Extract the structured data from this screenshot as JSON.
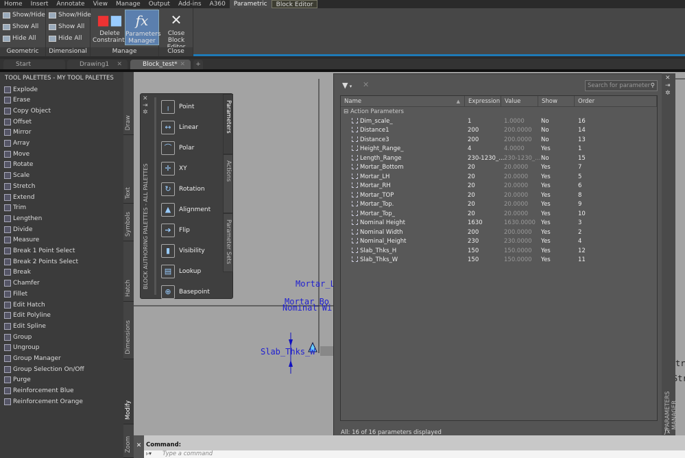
{
  "ribbon_tabs": [
    "Home",
    "Insert",
    "Annotate",
    "View",
    "Manage",
    "Output",
    "Add-ins",
    "A360",
    "Parametric",
    "Block Editor"
  ],
  "ribbon": {
    "geometric": {
      "items": [
        "Show/Hide",
        "Show All",
        "Hide All"
      ],
      "label": "Geometric"
    },
    "dimensional": {
      "items": [
        "Show/Hide",
        "Show All",
        "Hide All"
      ],
      "label": "Dimensional"
    },
    "manage": {
      "delete": "Delete Constraints",
      "params": "Parameters Manager",
      "label": "Manage"
    },
    "close": {
      "close": "Close Block Editor",
      "label": "Close"
    }
  },
  "doc_tabs": [
    "Start",
    "Drawing1",
    "Block_test*"
  ],
  "palette": {
    "title": "TOOL PALETTES - MY TOOL PALETTES",
    "items": [
      "Explode",
      "Erase",
      "Copy Object",
      "Offset",
      "Mirror",
      "Array",
      "Move",
      "Rotate",
      "Scale",
      "Stretch",
      "Extend",
      "Trim",
      "Lengthen",
      "Divide",
      "Measure",
      "Break 1 Point Select",
      "Break 2 Points Select",
      "Break",
      "Chamfer",
      "Fillet",
      "Edit Hatch",
      "Edit Polyline",
      "Edit Spline",
      "Group",
      "Ungroup",
      "Group Manager",
      "Group Selection On/Off",
      "Purge",
      "Reinforcement Blue",
      "Reinforcement Orange"
    ],
    "tabs": [
      "Draw",
      "Text",
      "Symbols",
      "Hatch",
      "Dimensions",
      "Modify",
      "Zoom"
    ],
    "active_tab": "Modify"
  },
  "block_palette": {
    "title": "BLOCK AUTHORING PALETTES - ALL PALETTES",
    "items": [
      "Point",
      "Linear",
      "Polar",
      "XY",
      "Rotation",
      "Alignment",
      "Flip",
      "Visibility",
      "Lookup",
      "Basepoint"
    ],
    "tabs": [
      "Parameters",
      "Actions",
      "Parameter Sets"
    ]
  },
  "drawing_labels": [
    "Mortar_L",
    "Mortar_Bo",
    "Nominal Wi",
    "Slab_Thks_W"
  ],
  "drawing_edge_text": [
    "tre",
    "Stre"
  ],
  "params_manager": {
    "title": "PARAMETERS MANAGER",
    "search_placeholder": "Search for parameter",
    "columns": [
      "Name",
      "Expression",
      "Value",
      "Show",
      "Order"
    ],
    "group": "Action Parameters",
    "rows": [
      [
        "Dim_scale_",
        "1",
        "1.0000",
        "No",
        "16"
      ],
      [
        "Distance1",
        "200",
        "200.0000",
        "No",
        "14"
      ],
      [
        "Distance3",
        "200",
        "200.0000",
        "No",
        "13"
      ],
      [
        "Height_Range_",
        "4",
        "4.0000",
        "Yes",
        "1"
      ],
      [
        "Length_Range",
        "230-1230_...",
        "230-1230_...",
        "No",
        "15"
      ],
      [
        "Mortar_Bottom",
        "20",
        "20.0000",
        "Yes",
        "7"
      ],
      [
        "Mortar_LH",
        "20",
        "20.0000",
        "Yes",
        "5"
      ],
      [
        "Mortar_RH",
        "20",
        "20.0000",
        "Yes",
        "6"
      ],
      [
        "Mortar_TOP",
        "20",
        "20.0000",
        "Yes",
        "8"
      ],
      [
        "Mortar_Top.",
        "20",
        "20.0000",
        "Yes",
        "9"
      ],
      [
        "Mortar_Top_",
        "20",
        "20.0000",
        "Yes",
        "10"
      ],
      [
        "Nominal Height",
        "1630",
        "1630.0000",
        "Yes",
        "3"
      ],
      [
        "Nominal Width",
        "200",
        "200.0000",
        "Yes",
        "2"
      ],
      [
        "Nominal_Height",
        "230",
        "230.0000",
        "Yes",
        "4"
      ],
      [
        "Slab_Thks_H",
        "150",
        "150.0000",
        "Yes",
        "12"
      ],
      [
        "Slab_Thks_W",
        "150",
        "150.0000",
        "Yes",
        "11"
      ]
    ],
    "status": "All: 16 of 16 parameters displayed"
  },
  "command": {
    "label": "Command:",
    "placeholder": "Type a command"
  }
}
